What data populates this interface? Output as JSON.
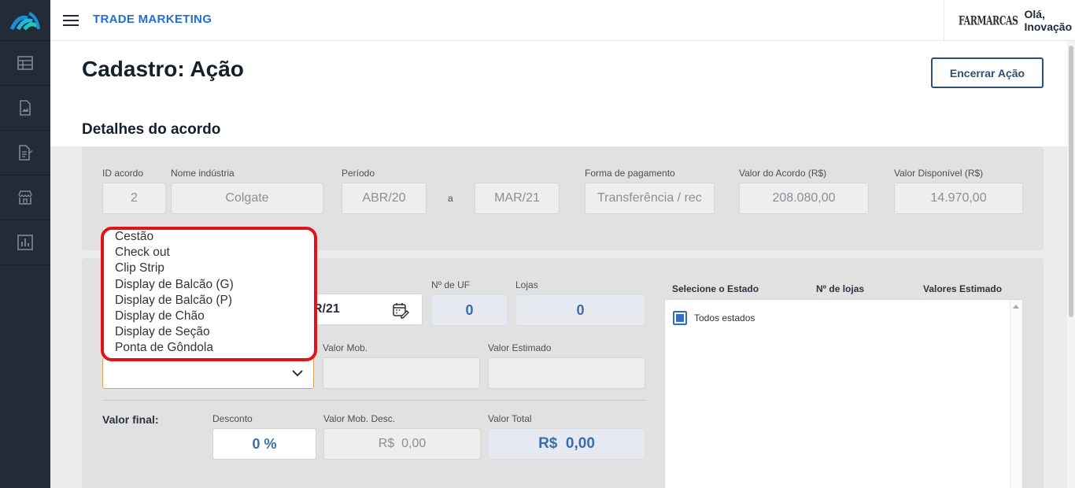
{
  "header": {
    "app_title": "TRADE MARKETING",
    "brand": "FARMARCAS",
    "greeting": "Olá, Inovação"
  },
  "sidebar": {
    "items": [
      {
        "icon": "table-icon"
      },
      {
        "icon": "image-document-icon"
      },
      {
        "icon": "report-document-icon"
      },
      {
        "icon": "store-icon"
      },
      {
        "icon": "bar-chart-icon"
      }
    ]
  },
  "page": {
    "title": "Cadastro: Ação",
    "end_button": "Encerrar Ação",
    "section_title": "Detalhes do acordo"
  },
  "agreement": {
    "id_label": "ID acordo",
    "id_value": "2",
    "industry_label": "Nome indústria",
    "industry_value": "Colgate",
    "period_label": "Período",
    "period_from": "ABR/20",
    "period_sep": "a",
    "period_to": "MAR/21",
    "payment_label": "Forma de pagamento",
    "payment_value": "Transferência / rec",
    "agreement_value_label": "Valor do Acordo (R$)",
    "agreement_value": "208.080,00",
    "available_label": "Valor Disponível (R$)",
    "available_value": "14.970,00"
  },
  "action": {
    "date_value": "R/21",
    "uf_label": "Nº de UF",
    "uf_value": "0",
    "stores_label": "Lojas",
    "stores_value": "0",
    "mob_label": "Valor Mob.",
    "estimated_label": "Valor Estimado",
    "final_label": "Valor final:",
    "discount_label": "Desconto",
    "discount_value": "0 %",
    "mob_desc_label": "Valor Mob. Desc.",
    "mob_desc_value": "R$  0,00",
    "total_label": "Valor Total",
    "total_value": "R$  0,00"
  },
  "states": {
    "col_state": "Selecione o Estado",
    "col_stores": "Nº de lojas",
    "col_values": "Valores Estimado",
    "all_states": "Todos estados"
  },
  "dropdown": {
    "options": [
      "Cestão",
      "Check out",
      "Clip Strip",
      "Display de Balcão (G)",
      "Display de Balcão (P)",
      "Display de Chão",
      "Display de Seção",
      "Ponta de Gôndola"
    ]
  },
  "colors": {
    "accent_blue": "#1f6fd6",
    "sidebar_bg": "#232b37",
    "highlight_red": "#e0121a"
  }
}
